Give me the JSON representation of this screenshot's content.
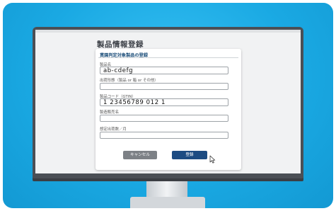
{
  "page": {
    "title": "製品情報登録"
  },
  "form": {
    "section_header": "貫園判定対象製品の登録",
    "fields": [
      {
        "label": "製品名",
        "value": "ab-cdefg"
      },
      {
        "label": "出荷形態（製品 or 箱 or その他）",
        "value": ""
      },
      {
        "label": "製品コード（GTIN）",
        "value": "1 23456789 012 1"
      },
      {
        "label": "製造販売名",
        "value": ""
      },
      {
        "label": "想定出荷数／月",
        "value": ""
      }
    ],
    "cancel_label": "キャンセル",
    "submit_label": "登録"
  },
  "colors": {
    "background": "#16a9e4",
    "submit": "#1c4b82",
    "cancel": "#7d8186"
  },
  "icons": {
    "cursor": "pointer-cursor-icon"
  }
}
